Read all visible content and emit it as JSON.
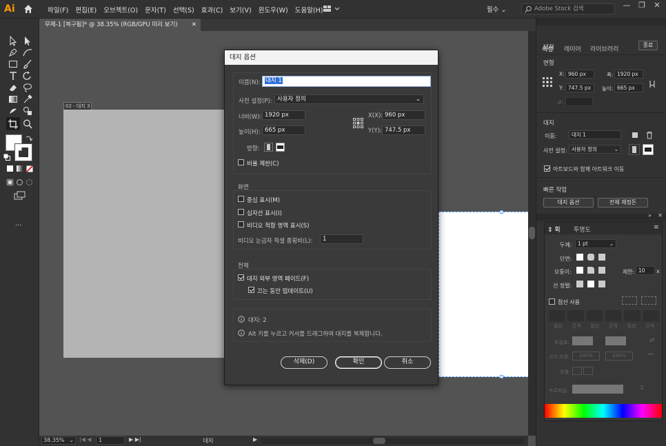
{
  "app": {
    "logo": "Ai",
    "menus": [
      "파일(F)",
      "편집(E)",
      "오브젝트(O)",
      "문자(T)",
      "선택(S)",
      "효과(C)",
      "보기(V)",
      "윈도우(W)",
      "도움말(H)"
    ],
    "workspace": "필수",
    "search_placeholder": "Adobe Stock 검색",
    "window_controls": [
      "—",
      "❐",
      "✕"
    ]
  },
  "document": {
    "tab_title": "무제-1 [복구됨]* @ 38.35% (RGB/GPU 미리 보기)",
    "artboard1_label": "02 - 대지 3"
  },
  "status": {
    "zoom": "38.35%",
    "page": "1",
    "tool": "대지"
  },
  "right_panel": {
    "tabs": [
      "속성",
      "레이어",
      "라이브러리"
    ],
    "artboard_section": "대지",
    "done_button": "종료",
    "transform_title": "변형",
    "x_label": "X:",
    "x_value": "960 px",
    "w_label": "폭:",
    "w_value": "1920 px",
    "y_label": "Y:",
    "y_value": "747.5 px",
    "h_label": "높이:",
    "h_value": "665 px",
    "angle_label": "⊿:",
    "artboard_title": "대지",
    "name_label": "이름:",
    "name_value": "대지 1",
    "preset_label": "사전 설정:",
    "preset_value": "사용자 정의",
    "move_with_art": "아트보드와 함께 아트워크 이동",
    "quick_actions": "빠른 작업",
    "artboard_options_button": "대지 옵션",
    "rearrange_all_button": "전체 재정돈"
  },
  "stroke_panel": {
    "tabs": [
      "획",
      "투명도"
    ],
    "weight_label": "두께:",
    "weight_value": "1 pt",
    "cap_label": "단면:",
    "corner_label": "모퉁이:",
    "limit_label": "제한:",
    "limit_value": "10",
    "limit_unit": "x",
    "align_label": "선 정렬:",
    "dashed_label": "점선 사용",
    "dash_cols": [
      "점선",
      "간격",
      "점선",
      "간격",
      "점선",
      "간격"
    ],
    "arrow_label": "화살표:",
    "scale_label": "크기 조정:",
    "scale_value1": "100%",
    "scale_value2": "100%",
    "align2_label": "정렬:",
    "profile_label": "프로파일:"
  },
  "dialog": {
    "title": "대지 옵션",
    "name_label": "이름(N):",
    "name_value": "대지 1",
    "preset_label": "사전 설정(P):",
    "preset_value": "사용자 정의",
    "width_label": "너비(W):",
    "width_value": "1920 px",
    "height_label": "높이(H):",
    "height_value": "665 px",
    "x_label": "X(X):",
    "x_value": "960 px",
    "y_label": "Y(Y):",
    "y_value": "747.5 px",
    "orientation_label": "방향:",
    "constrain_label": "비율 제한(C)",
    "display_section": "화면",
    "show_center": "중심 표시(M)",
    "show_crosshairs": "십자선 표시(I)",
    "show_video_safe": "비디오 적합 영역 표시(S)",
    "pixel_ratio_label": "비디오 눈금자 픽셀 종횡비(L):",
    "pixel_ratio_value": "1",
    "global_section": "전체",
    "fade_outside": "대지 외부 영역 페이드(F)",
    "update_drag": "끄는 동안 업데이트(U)",
    "info_count": "대지: 2",
    "info_alt": "Alt 키를 누르고 커서를 드래그하여 대지를 복제합니다.",
    "delete_button": "삭제(D)",
    "ok_button": "확인",
    "cancel_button": "취소"
  },
  "colors": {
    "accent": "#ff9a00",
    "selection": "#2f6fd6",
    "panel_bg": "#323232",
    "dialog_bg": "#3a3a3a"
  }
}
